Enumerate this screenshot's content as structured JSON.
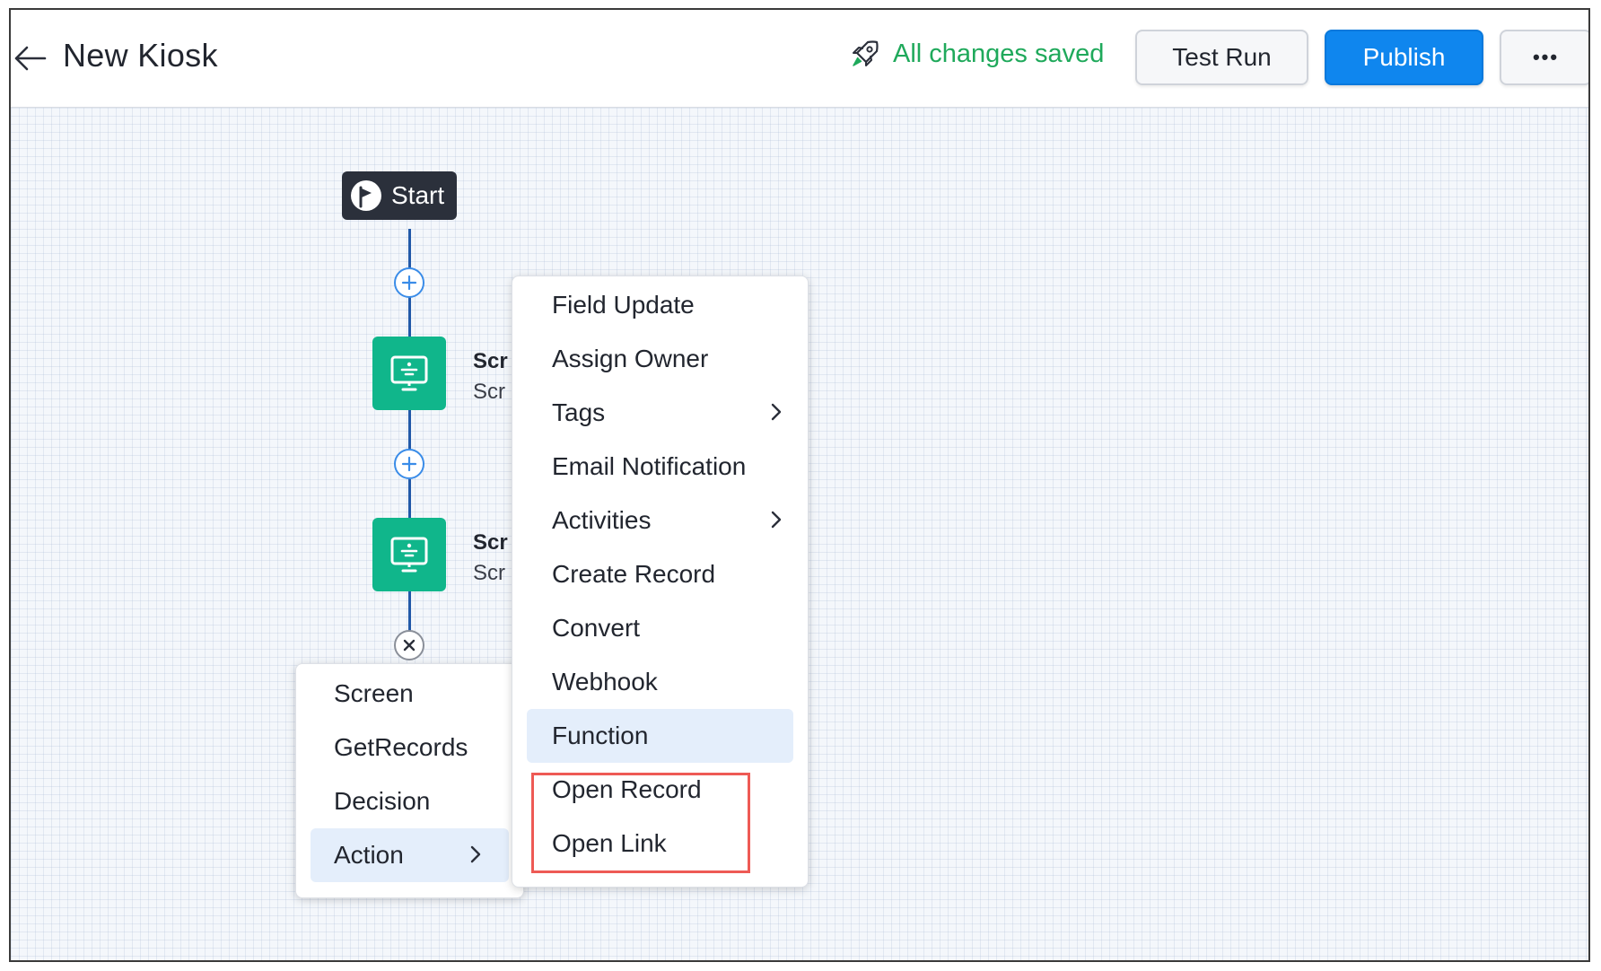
{
  "header": {
    "title": "New Kiosk",
    "status_text": "All changes saved",
    "test_run_label": "Test Run",
    "publish_label": "Publish",
    "more_label": "•••"
  },
  "flow": {
    "start_label": "Start",
    "nodes": [
      {
        "title": "Scr",
        "subtitle": "Scr"
      },
      {
        "title": "Scr",
        "subtitle": "Scr"
      }
    ]
  },
  "add_menu": {
    "items": [
      "Screen",
      "GetRecords",
      "Decision",
      "Action"
    ]
  },
  "action_submenu": {
    "items": [
      "Field Update",
      "Assign Owner",
      "Tags",
      "Email Notification",
      "Activities",
      "Create Record",
      "Convert",
      "Webhook",
      "Function",
      "Open Record",
      "Open Link"
    ],
    "highlighted": "Function",
    "annotated": [
      "Open Record",
      "Open Link"
    ]
  },
  "colors": {
    "accent": "#0f86ee",
    "success": "#1fa95b",
    "node": "#10b68b",
    "connector": "#2159a8",
    "annotation": "#ee5a55"
  }
}
